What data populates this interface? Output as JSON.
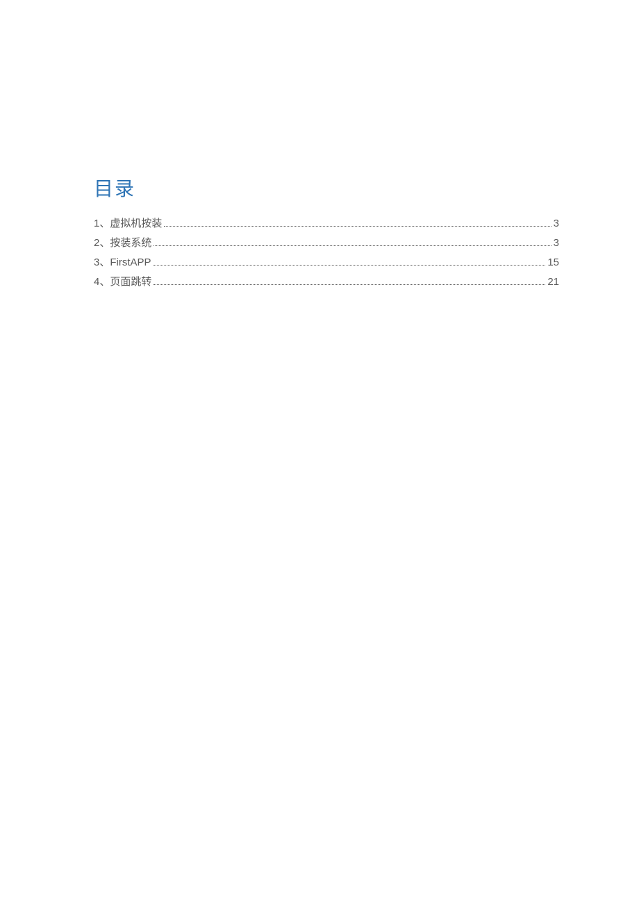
{
  "toc": {
    "title": "目录",
    "entries": [
      {
        "label": "1、虚拟机按装",
        "page": "3"
      },
      {
        "label": "2、按装系统",
        "page": "3"
      },
      {
        "label": "3、FirstAPP",
        "page": "15"
      },
      {
        "label": "4、页面跳转",
        "page": "21"
      }
    ]
  }
}
